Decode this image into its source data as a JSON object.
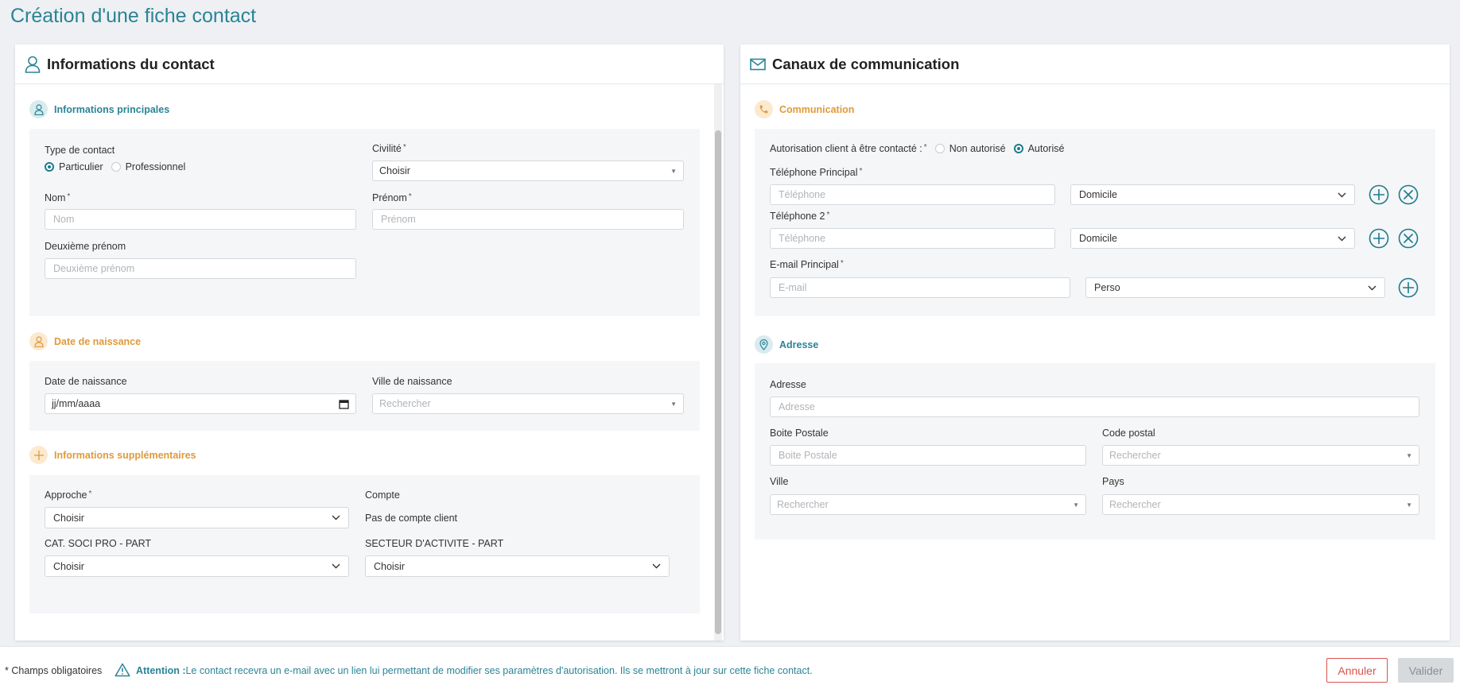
{
  "page_title": "Création d'une fiche contact",
  "contact_card": {
    "title": "Informations du contact",
    "main_section": {
      "title": "Informations principales",
      "type_label": "Type de contact",
      "type_options": [
        "Particulier",
        "Professionnel"
      ],
      "type_selected": "Particulier",
      "civilite_label": "Civilité",
      "civilite_value": "Choisir",
      "nom_label": "Nom",
      "nom_placeholder": "Nom",
      "prenom_label": "Prénom",
      "prenom_placeholder": "Prénom",
      "deuxieme_label": "Deuxième prénom",
      "deuxieme_placeholder": "Deuxième prénom"
    },
    "birth_section": {
      "title": "Date de naissance",
      "date_label": "Date de naissance",
      "date_placeholder": "jj/mm/aaaa",
      "ville_label": "Ville de naissance",
      "ville_placeholder": "Rechercher"
    },
    "extra_section": {
      "title": "Informations supplémentaires",
      "approche_label": "Approche",
      "approche_value": "Choisir",
      "compte_label": "Compte",
      "compte_value": "Pas de compte client",
      "csp_label": "CAT. SOCI PRO - PART",
      "csp_value": "Choisir",
      "secteur_label": "SECTEUR D'ACTIVITE - PART",
      "secteur_value": "Choisir"
    }
  },
  "comm_card": {
    "title": "Canaux de communication",
    "comm_section": {
      "title": "Communication",
      "autorisation_label": "Autorisation client à être contacté :",
      "autorisation_options": [
        "Non autorisé",
        "Autorisé"
      ],
      "autorisation_selected": "Autorisé",
      "tel1_label": "Téléphone Principal",
      "tel1_placeholder": "Téléphone",
      "tel1_type": "Domicile",
      "tel2_label": "Téléphone 2",
      "tel2_placeholder": "Téléphone",
      "tel2_type": "Domicile",
      "email_label": "E-mail Principal",
      "email_placeholder": "E-mail",
      "email_type": "Perso"
    },
    "address_section": {
      "title": "Adresse",
      "adresse_label": "Adresse",
      "adresse_placeholder": "Adresse",
      "bp_label": "Boite Postale",
      "bp_placeholder": "Boite Postale",
      "cp_label": "Code postal",
      "cp_placeholder": "Rechercher",
      "ville_label": "Ville",
      "ville_placeholder": "Rechercher",
      "pays_label": "Pays",
      "pays_placeholder": "Rechercher"
    }
  },
  "footer": {
    "required_note": "* Champs obligatoires",
    "attention_label": "Attention :",
    "attention_text": "Le contact recevra un e-mail avec un lien lui permettant de modifier ses paramètres d'autorisation. Ils se mettront à jour sur cette fiche contact.",
    "cancel_label": "Annuler",
    "validate_label": "Valider"
  },
  "colors": {
    "teal": "#2a8496",
    "orange": "#e09a3a",
    "cancel_red": "#d9534f"
  }
}
